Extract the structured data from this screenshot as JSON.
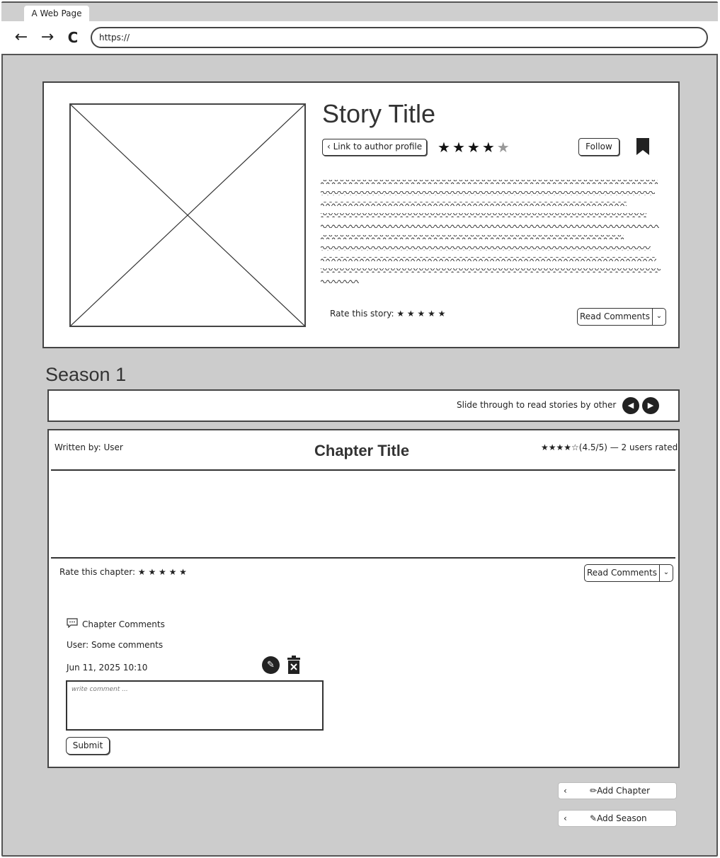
{
  "browser": {
    "tab_title": "A Web Page",
    "url": "https://",
    "back_icon": "←",
    "forward_icon": "→",
    "reload_icon": "C"
  },
  "story": {
    "title": "Story Title",
    "author_link": "Link to author profile",
    "rating": 4,
    "rating_max": 5,
    "follow_label": "Follow",
    "rate_label": "Rate this story: ★ ★ ★ ★ ★",
    "read_comments_label": "Read Comments",
    "cover_icon": "image-placeholder-icon",
    "bookmark_icon": "bookmark-icon"
  },
  "season": {
    "title": "Season 1",
    "slider_text": "Slide through to read stories by other"
  },
  "chapter": {
    "written_by": "Written by: User",
    "title": "Chapter Title",
    "rating_text": "★★★★☆(4.5/5) — 2 users rated",
    "rate_label": "Rate this chapter: ★ ★ ★ ★ ★",
    "read_comments_label": "Read Comments",
    "comments_header": "Chapter Comments",
    "comment_text": "User: Some comments",
    "comment_date": "Jun 11, 2025 10:10",
    "comment_placeholder": "write comment ...",
    "submit_label": "Submit"
  },
  "actions": {
    "add_chapter": "Add Chapter",
    "add_season": "Add Season"
  },
  "colors": {
    "page_bg": "#cccccc",
    "card_bg": "#ffffff",
    "ink": "#222222"
  }
}
